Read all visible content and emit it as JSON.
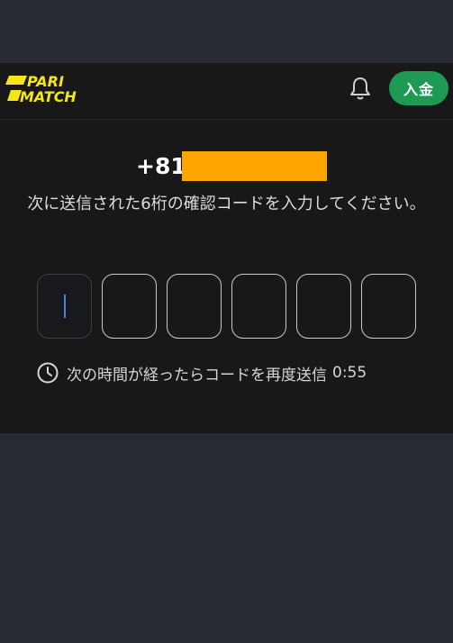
{
  "header": {
    "logo_text": "PARIMATCH",
    "logo_color": "#f5e614",
    "deposit_label": "入金",
    "deposit_color": "#1e9a55",
    "notification_icon": "bell-icon"
  },
  "verification": {
    "phone_prefix": "+81",
    "phone_redaction_color": "#ffa500",
    "instruction": "次に送信された6桁の確認コードを入力してください。",
    "code_length": 6,
    "code_values": [
      "",
      "",
      "",
      "",
      "",
      ""
    ],
    "resend_icon": "clock-icon",
    "resend_text": "次の時間が経ったらコードを再度送信",
    "resend_timer": "0:55"
  }
}
